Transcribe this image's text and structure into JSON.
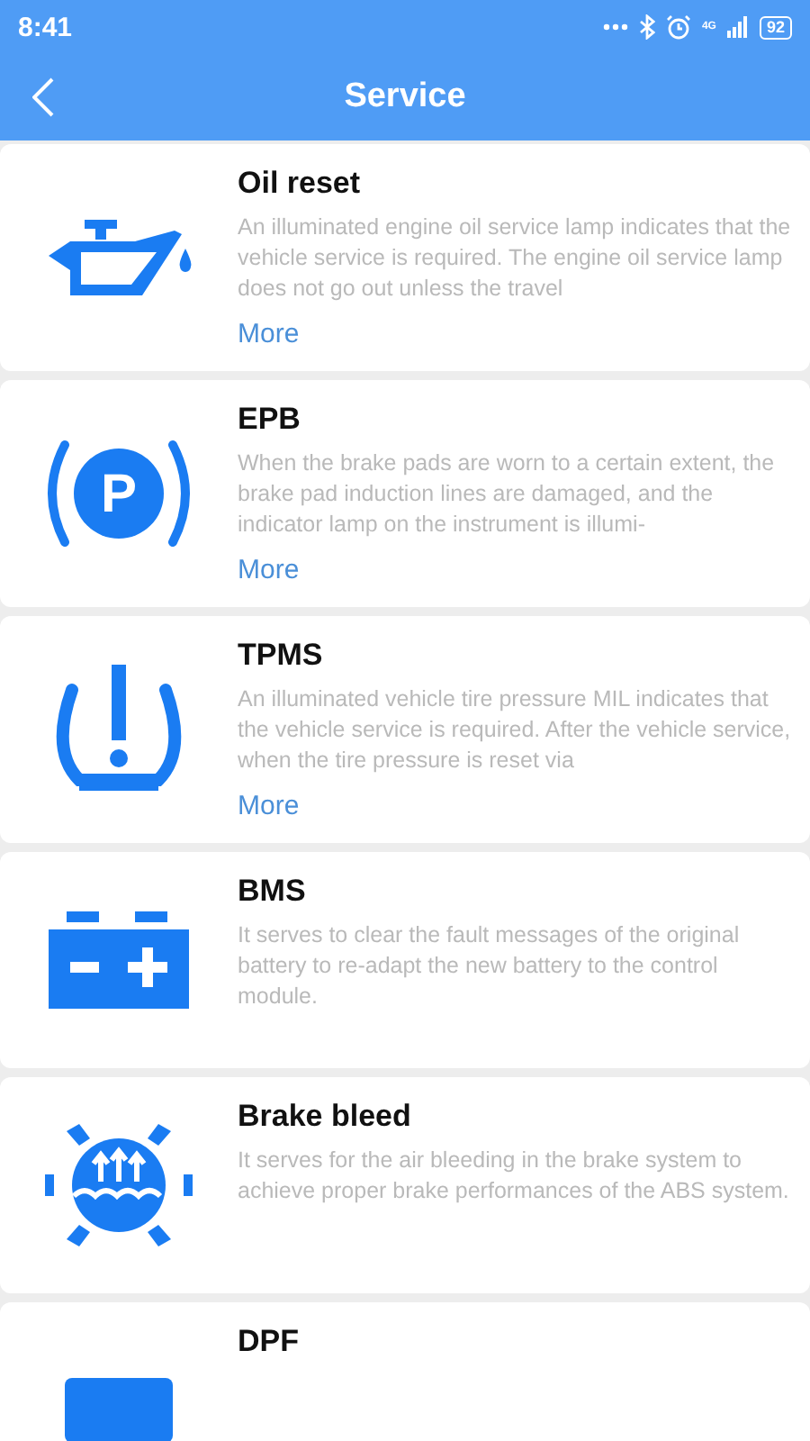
{
  "status_bar": {
    "time": "8:41",
    "network": "4G",
    "battery": "92"
  },
  "header": {
    "title": "Service"
  },
  "services": [
    {
      "kind": "oil",
      "title": "Oil reset",
      "description": "An illuminated engine oil service lamp indicates that the vehicle service is required. The engine oil service lamp does not go out unless the travel",
      "more": "More"
    },
    {
      "kind": "parking",
      "symbol": "P",
      "title": "EPB",
      "description": "When the brake pads are worn to a certain extent, the brake pad induction lines are damaged, and the indicator lamp on the instrument is illumi-",
      "more": "More"
    },
    {
      "kind": "tpms",
      "title": "TPMS",
      "description": "An illuminated vehicle tire pressure MIL indicates that the vehicle service is required. After the vehicle service, when the tire pressure is reset via",
      "more": "More"
    },
    {
      "kind": "battery",
      "title": "BMS",
      "description": "It serves to clear the fault messages of the original battery to re-adapt the new battery to the control module."
    },
    {
      "kind": "brake",
      "title": "Brake bleed",
      "description": "It serves for the air bleeding in the brake system to achieve proper brake performances of the ABS system."
    },
    {
      "kind": "dpf",
      "title": "DPF"
    }
  ]
}
